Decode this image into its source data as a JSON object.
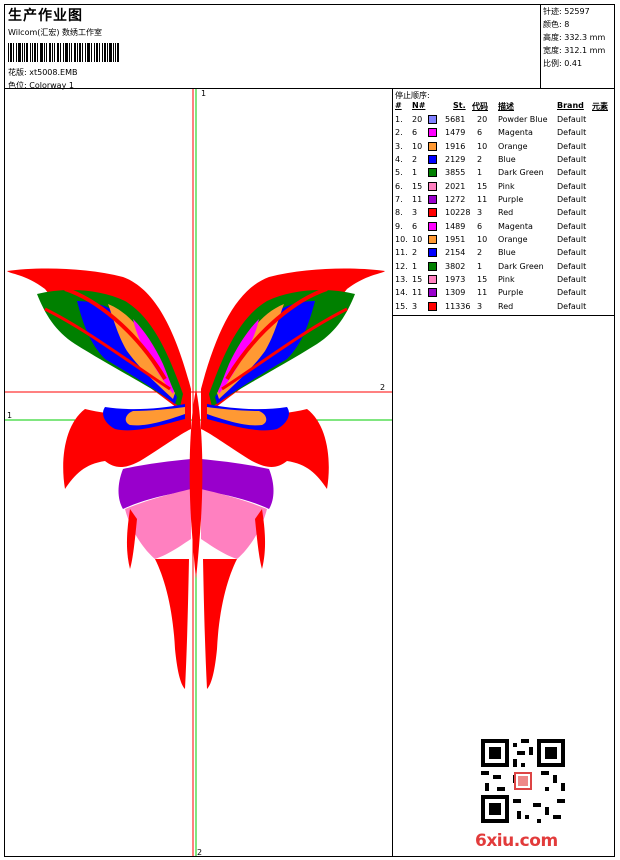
{
  "header": {
    "title": "生产作业图",
    "subtitle": "Wilcom(汇宏) 数绣工作室",
    "file_label": "花版:",
    "file_name": "xt5008.EMB",
    "color_label": "色位:",
    "color_name": "Colorway 1"
  },
  "stats": {
    "stitches": "针迹: 52597",
    "colors": "颜色: 8",
    "height": "高度: 332.3 mm",
    "width": "宽度: 312.1 mm",
    "scale": "比例: 0.41"
  },
  "stop_sequence": {
    "title": "停止顺序:",
    "columns": [
      "#",
      "N#",
      "St.",
      "代码",
      "描述",
      "Brand",
      "元素"
    ],
    "rows": [
      {
        "idx": "1.",
        "n": "20",
        "st": "5681",
        "code": "20",
        "desc": "Powder Blue",
        "brand": "Default",
        "color": "#8080ff"
      },
      {
        "idx": "2.",
        "n": "6",
        "st": "1479",
        "code": "6",
        "desc": "Magenta",
        "brand": "Default",
        "color": "#ff00ff"
      },
      {
        "idx": "3.",
        "n": "10",
        "st": "1916",
        "code": "10",
        "desc": "Orange",
        "brand": "Default",
        "color": "#ff9933"
      },
      {
        "idx": "4.",
        "n": "2",
        "st": "2129",
        "code": "2",
        "desc": "Blue",
        "brand": "Default",
        "color": "#0000ff"
      },
      {
        "idx": "5.",
        "n": "1",
        "st": "3855",
        "code": "1",
        "desc": "Dark Green",
        "brand": "Default",
        "color": "#008000"
      },
      {
        "idx": "6.",
        "n": "15",
        "st": "2021",
        "code": "15",
        "desc": "Pink",
        "brand": "Default",
        "color": "#ff80c0"
      },
      {
        "idx": "7.",
        "n": "11",
        "st": "1272",
        "code": "11",
        "desc": "Purple",
        "brand": "Default",
        "color": "#9900cc"
      },
      {
        "idx": "8.",
        "n": "3",
        "st": "10228",
        "code": "3",
        "desc": "Red",
        "brand": "Default",
        "color": "#ff0000"
      },
      {
        "idx": "9.",
        "n": "6",
        "st": "1489",
        "code": "6",
        "desc": "Magenta",
        "brand": "Default",
        "color": "#ff00ff"
      },
      {
        "idx": "10.",
        "n": "10",
        "st": "1951",
        "code": "10",
        "desc": "Orange",
        "brand": "Default",
        "color": "#ff9933"
      },
      {
        "idx": "11.",
        "n": "2",
        "st": "2154",
        "code": "2",
        "desc": "Blue",
        "brand": "Default",
        "color": "#0000ff"
      },
      {
        "idx": "12.",
        "n": "1",
        "st": "3802",
        "code": "1",
        "desc": "Dark Green",
        "brand": "Default",
        "color": "#008000"
      },
      {
        "idx": "13.",
        "n": "15",
        "st": "1973",
        "code": "15",
        "desc": "Pink",
        "brand": "Default",
        "color": "#ff80c0"
      },
      {
        "idx": "14.",
        "n": "11",
        "st": "1309",
        "code": "11",
        "desc": "Purple",
        "brand": "Default",
        "color": "#9900cc"
      },
      {
        "idx": "15.",
        "n": "3",
        "st": "11336",
        "code": "3",
        "desc": "Red",
        "brand": "Default",
        "color": "#ff0000"
      }
    ]
  },
  "axis_labels": {
    "v_top": "1",
    "v_bottom": "2",
    "h_green": "1",
    "h_red": "2"
  },
  "watermark": {
    "site": "6xiu.com"
  },
  "colors": {
    "red": "#ff0000",
    "green": "#00cc00",
    "guide_red": "#ff0000"
  }
}
